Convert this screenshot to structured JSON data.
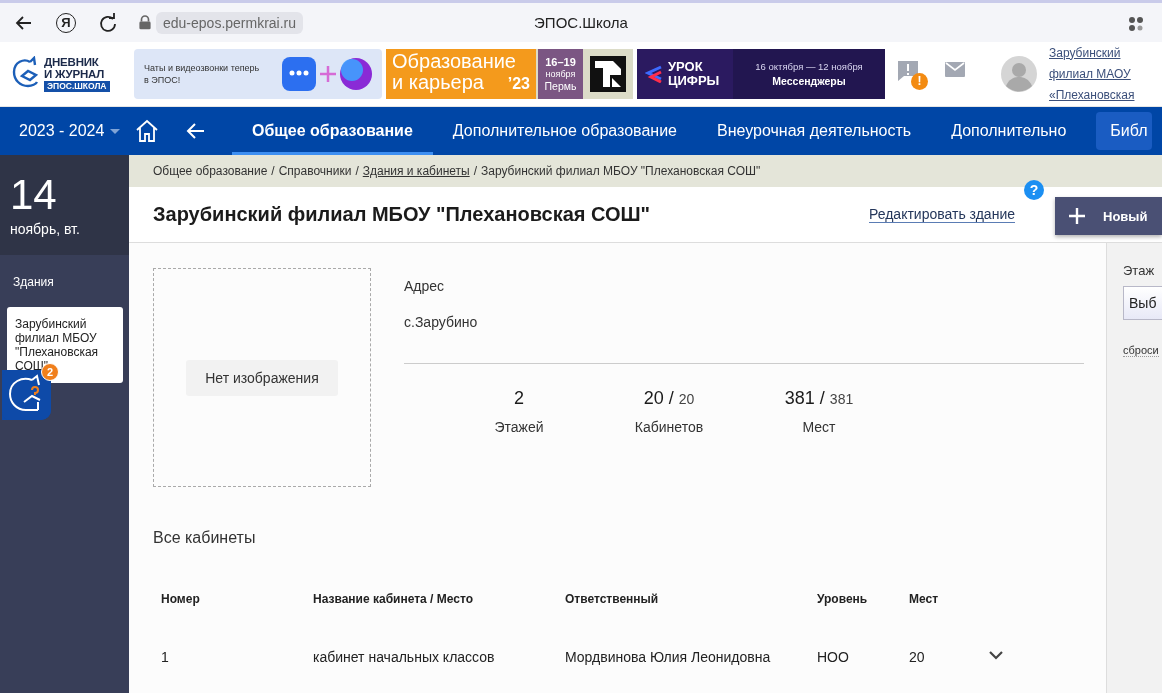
{
  "browser": {
    "glyph": "Я",
    "url": "edu-epos.permkrai.ru",
    "title": "ЭПОС.Школа"
  },
  "header": {
    "logo": {
      "line_1": "ДНЕВНИК",
      "line_2": "И ЖУРНАЛ",
      "badge": "ЭПОС.ШКОЛА"
    },
    "banners": [
      {
        "kind": "chat",
        "text": "Чаты и видеозвонки теперь в ЭПОС!"
      },
      {
        "kind": "career",
        "title_lines": [
          "Образование",
          "и карьера"
        ],
        "year": "’23",
        "dates": "16–19",
        "month": "ноября",
        "city": "Пермь"
      },
      {
        "kind": "digital",
        "title_lines": [
          "УРОК",
          "ЦИФРЫ"
        ],
        "dates": "16 октября — 12 ноября",
        "topic": "Мессенджеры"
      }
    ],
    "feedback_badge": "!",
    "user": "Зарубинский филиал МАОУ «Плехановская"
  },
  "nav": {
    "year": "2023 - 2024",
    "tabs": [
      {
        "label": "Общее образование",
        "selected": true
      },
      {
        "label": "Дополнительное образование",
        "selected": false
      },
      {
        "label": "Внеурочная деятельность",
        "selected": false
      },
      {
        "label": "Дополнительно",
        "selected": false
      }
    ],
    "button": "Библ"
  },
  "date": {
    "day": "14",
    "label": "ноябрь, вт."
  },
  "sidebar": {
    "heading": "Здания",
    "items": [
      {
        "label": "Зарубинский филиал МБОУ \"Плехановская СОШ\"",
        "selected": true
      }
    ]
  },
  "helper": {
    "badge": "2"
  },
  "breadcrumb": {
    "separator": "/",
    "items": [
      {
        "label": "Общее образование",
        "link": false
      },
      {
        "label": "Справочники",
        "link": false
      },
      {
        "label": "Здания и кабинеты",
        "link": true
      },
      {
        "label": "Зарубинский филиал МБОУ \"Плехановская СОШ\"",
        "link": false
      }
    ]
  },
  "page": {
    "title": "Зарубинский филиал МБОУ \"Плехановская СОШ\"",
    "edit_link": "Редактировать здание",
    "help": "?",
    "new_button": "Новый"
  },
  "building": {
    "no_image": "Нет изображения",
    "address_label": "Адрес",
    "address": "с.Зарубино",
    "stats": [
      {
        "value": "2",
        "label": "Этажей"
      },
      {
        "value": "20 /",
        "total": "20",
        "label": "Кабинетов"
      },
      {
        "value": "381 /",
        "total": "381",
        "label": "Мест"
      }
    ]
  },
  "rooms": {
    "heading": "Все кабинеты",
    "columns": [
      "Номер",
      "Название кабинета / Место",
      "Ответственный",
      "Уровень",
      "Мест"
    ],
    "rows": [
      {
        "number": "1",
        "name": "кабинет начальных классов",
        "responsible": "Мордвинова Юлия Леонидовна",
        "level": "НОО",
        "seats": "20",
        "expanded": false
      }
    ]
  },
  "filter": {
    "label": "Этаж",
    "select": "Выб",
    "reset": "сброси"
  }
}
